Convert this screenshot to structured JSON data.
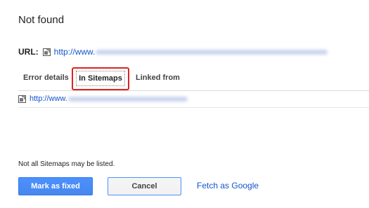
{
  "page": {
    "title": "Not found",
    "url_label": "URL:",
    "url_value": "http://www.",
    "url_icon": "external-link-icon"
  },
  "tabs": [
    {
      "label": "Error details",
      "active": false
    },
    {
      "label": "In Sitemaps",
      "active": true
    },
    {
      "label": "Linked from",
      "active": false
    }
  ],
  "sitemap_result": {
    "url_value": "http://www.",
    "icon": "external-link-icon"
  },
  "note": "Not all Sitemaps may be listed.",
  "actions": {
    "mark_fixed_label": "Mark as fixed",
    "cancel_label": "Cancel",
    "fetch_label": "Fetch as Google"
  },
  "colors": {
    "link": "#1155cc",
    "primary_button": "#4d90fe",
    "highlight_box": "#dd2222"
  }
}
